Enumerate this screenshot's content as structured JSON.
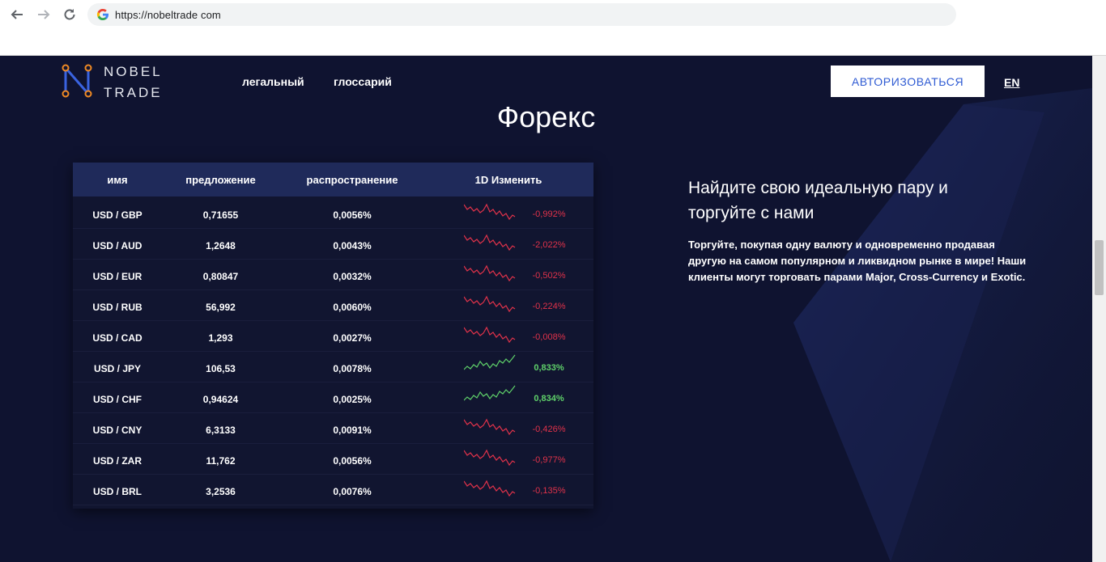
{
  "browser": {
    "url": "https://nobeltrade com",
    "back_icon": "arrow-left-icon",
    "forward_icon": "arrow-right-icon",
    "reload_icon": "reload-icon"
  },
  "header": {
    "logo_line1": "NOBEL",
    "logo_line2": "TRADE",
    "nav": [
      "легальный",
      "глоссарий"
    ],
    "auth_label": "АВТОРИЗОВАТЬСЯ",
    "lang": "EN"
  },
  "colors": {
    "page_bg": "#0f1330",
    "table_header_bg": "#1f2a5a",
    "negative": "#e0324a",
    "positive": "#5fd16a",
    "accent": "#2f5bd3",
    "logo_nodes": "#f08a24"
  },
  "page_title": "Форекс",
  "table": {
    "headers": [
      "имя",
      "предложение",
      "распространение",
      "1D Изменить"
    ],
    "rows": [
      {
        "name": "USD / GBP",
        "offer": "0,71655",
        "spread": "0,0056%",
        "change": "-0,992%",
        "trend": "down"
      },
      {
        "name": "USD / AUD",
        "offer": "1,2648",
        "spread": "0,0043%",
        "change": "-2,022%",
        "trend": "down"
      },
      {
        "name": "USD / EUR",
        "offer": "0,80847",
        "spread": "0,0032%",
        "change": "-0,502%",
        "trend": "down"
      },
      {
        "name": "USD / RUB",
        "offer": "56,992",
        "spread": "0,0060%",
        "change": "-0,224%",
        "trend": "down"
      },
      {
        "name": "USD / CAD",
        "offer": "1,293",
        "spread": "0,0027%",
        "change": "-0,008%",
        "trend": "down"
      },
      {
        "name": "USD / JPY",
        "offer": "106,53",
        "spread": "0,0078%",
        "change": "0,833%",
        "trend": "up"
      },
      {
        "name": "USD / CHF",
        "offer": "0,94624",
        "spread": "0,0025%",
        "change": "0,834%",
        "trend": "up"
      },
      {
        "name": "USD / CNY",
        "offer": "6,3133",
        "spread": "0,0091%",
        "change": "-0,426%",
        "trend": "down"
      },
      {
        "name": "USD / ZAR",
        "offer": "11,762",
        "spread": "0,0056%",
        "change": "-0,977%",
        "trend": "down"
      },
      {
        "name": "USD / BRL",
        "offer": "3,2536",
        "spread": "0,0076%",
        "change": "-0,135%",
        "trend": "down"
      }
    ]
  },
  "side": {
    "title": "Найдите свою идеальную пару и торгуйте с нами",
    "text": "Торгуйте, покупая одну валюту и одновременно продавая другую на самом популярном и ликвидном рынке в мире! Наши клиенты могут торговать парами Major, Cross-Currency и Exotic."
  }
}
